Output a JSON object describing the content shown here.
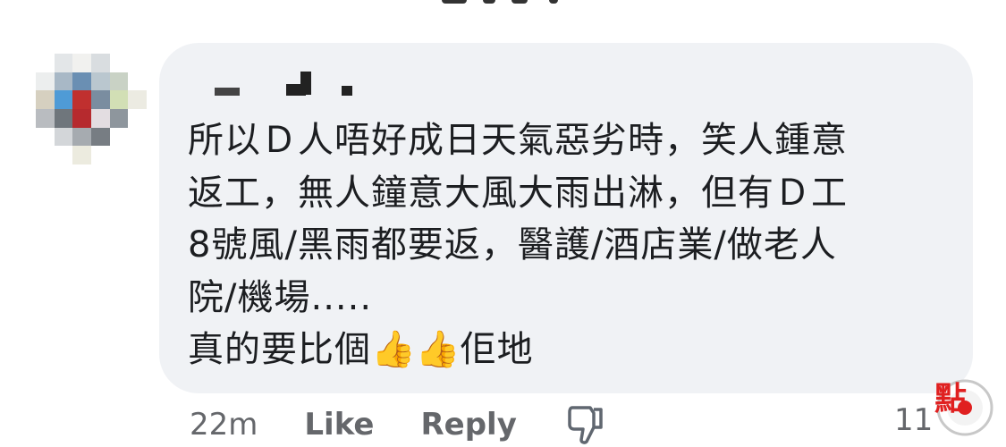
{
  "comment": {
    "lines": [
      "所以Ｄ人唔好成日天氣惡劣時，笑人鍾意",
      "返工，無人鐘意大風大雨出淋，但有Ｄ工",
      "8號風/黑雨都要返，醫護/酒店業/做老人",
      "院/機場....."
    ],
    "last_line_prefix": "真的要比個",
    "emoji": "👍👍",
    "last_line_suffix": "佢地"
  },
  "actions": {
    "timestamp": "22m",
    "like_label": "Like",
    "reply_label": "Reply",
    "dislike_icon": "thumbs-down-icon"
  },
  "reaction_count": "11",
  "watermark": {
    "text": "點",
    "color": "#e02020"
  },
  "colors": {
    "bubble": "#f0f2f5",
    "text": "#1c1e21",
    "meta": "#65676b"
  }
}
